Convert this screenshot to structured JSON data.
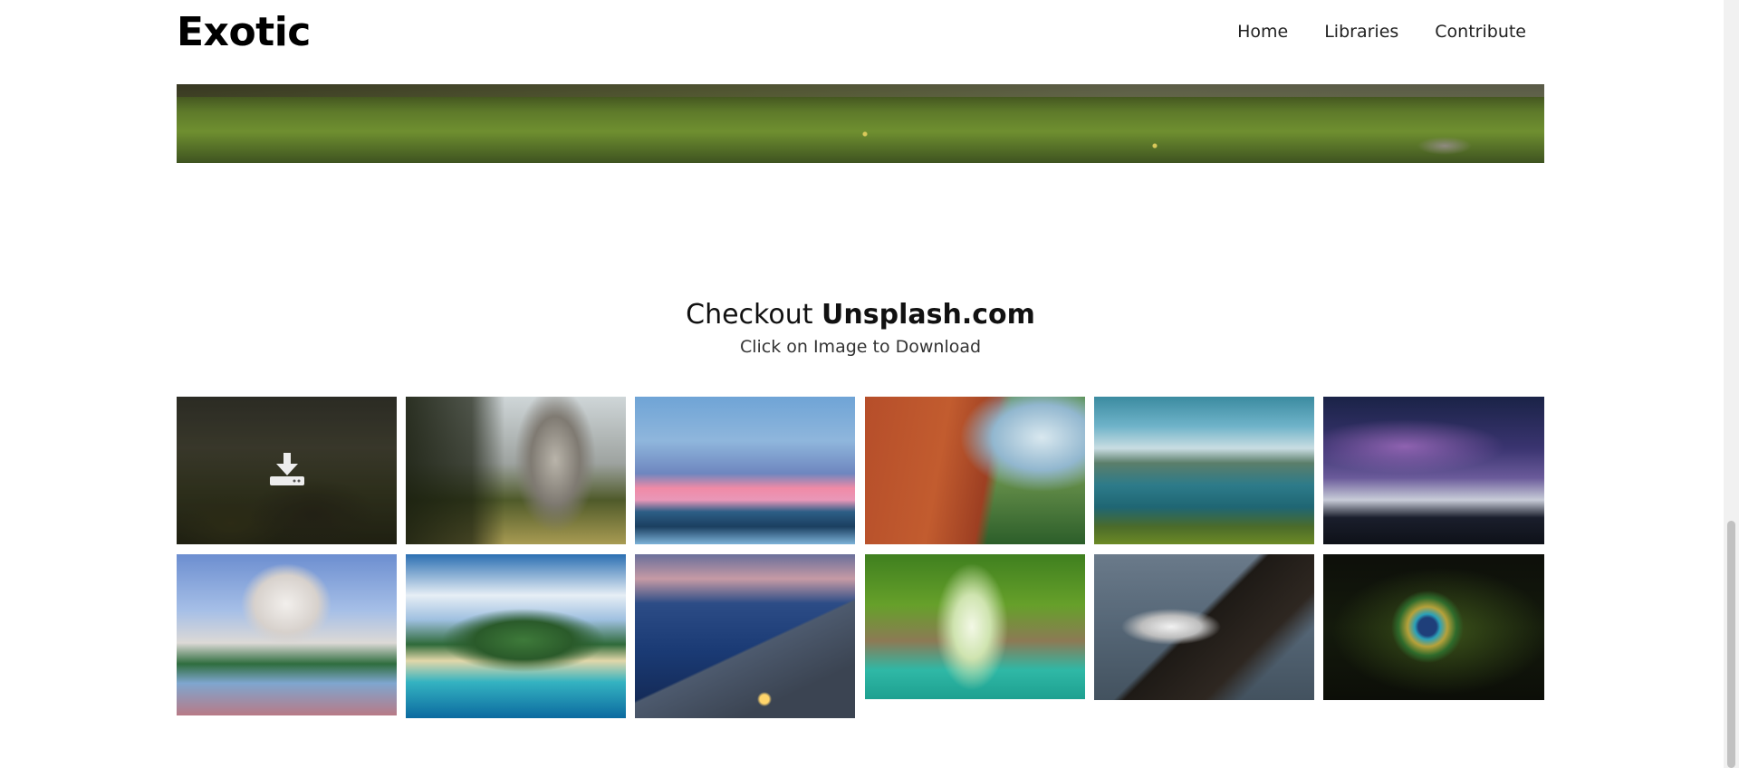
{
  "header": {
    "brand": "Exotic",
    "nav": [
      "Home",
      "Libraries",
      "Contribute"
    ]
  },
  "section": {
    "title_prefix": "Checkout",
    "title_brand": "Unsplash.com",
    "subtitle": "Click on Image to Download"
  },
  "gallery": {
    "items": [
      {
        "name": "gallery-image-misty-valley",
        "download_icon": "download-icon"
      },
      {
        "name": "gallery-image-pine-cliff"
      },
      {
        "name": "gallery-image-sunset-beach"
      },
      {
        "name": "gallery-image-red-canyon-waterfall"
      },
      {
        "name": "gallery-image-lake-island"
      },
      {
        "name": "gallery-image-milky-way-mountains"
      },
      {
        "name": "gallery-image-taj-mahal"
      },
      {
        "name": "gallery-image-tropical-island"
      },
      {
        "name": "gallery-image-dusk-seascape"
      },
      {
        "name": "gallery-image-jungle-lagoon"
      },
      {
        "name": "gallery-image-eagle"
      },
      {
        "name": "gallery-image-peacock-feather"
      }
    ]
  }
}
